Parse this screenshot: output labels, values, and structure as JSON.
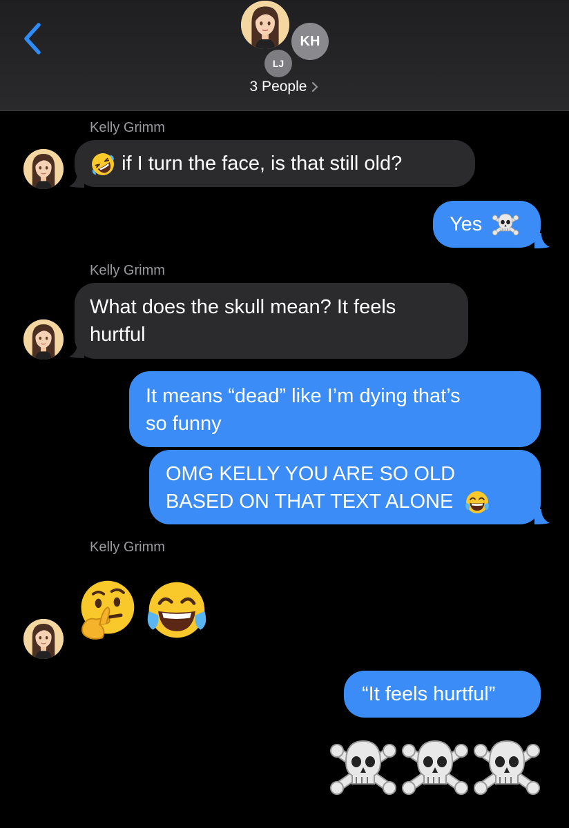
{
  "header": {
    "back_label": "Back",
    "group_avatar_name": "memoji",
    "avatar_kh": "KH",
    "avatar_lj": "LJ",
    "people_label": "3 People"
  },
  "colors": {
    "accent_blue": "#3b8cf6",
    "incoming_bubble": "#2b2b2e",
    "background": "#000000",
    "sender_name": "#9a9a9e"
  },
  "messages": [
    {
      "sender": "Kelly Grimm",
      "direction": "incoming",
      "emoji": "rolling-on-floor-laughing",
      "text": "if I turn the face, is that still old?"
    },
    {
      "direction": "outgoing",
      "text": "Yes",
      "emoji": "skull-and-crossbones"
    },
    {
      "sender": "Kelly Grimm",
      "direction": "incoming",
      "text_lines": [
        "What does the skull mean? It feels",
        "hurtful"
      ]
    },
    {
      "direction": "outgoing",
      "text_lines": [
        "It means “dead” like I’m dying that’s",
        "so funny"
      ]
    },
    {
      "direction": "outgoing",
      "text_lines": [
        "OMG KELLY YOU ARE SO OLD",
        "BASED ON THAT TEXT ALONE"
      ],
      "emoji": "face-with-tears-of-joy"
    },
    {
      "sender": "Kelly Grimm",
      "direction": "incoming",
      "emoji_only": [
        "thinking-face",
        "face-with-tears-of-joy"
      ]
    },
    {
      "direction": "outgoing",
      "text": "“It feels hurtful”"
    },
    {
      "direction": "outgoing",
      "emoji_only": [
        "skull-and-crossbones",
        "skull-and-crossbones",
        "skull-and-crossbones"
      ]
    }
  ]
}
